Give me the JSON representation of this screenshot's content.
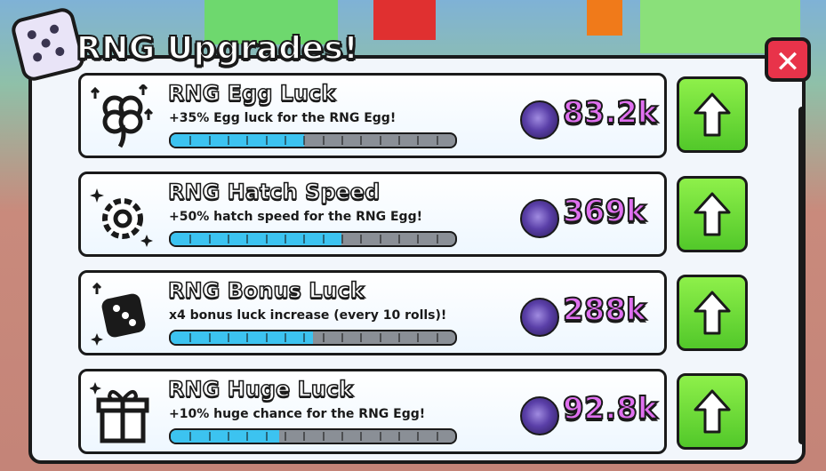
{
  "window": {
    "title": "RNG Upgrades!"
  },
  "close_label": "✕",
  "colors": {
    "accent_price": "#e070f0",
    "progress_fill": "#3cc3f0",
    "upgrade_button": "#6ed83a",
    "close_button": "#e8334a"
  },
  "upgrades": [
    {
      "name": "RNG Egg Luck",
      "description": "+35% Egg luck for the RNG Egg!",
      "price": "83.2k",
      "progress": 0.47,
      "icon": "clover-icon"
    },
    {
      "name": "RNG Hatch Speed",
      "description": "+50% hatch speed for the RNG Egg!",
      "price": "369k",
      "progress": 0.6,
      "icon": "gear-icon"
    },
    {
      "name": "RNG Bonus Luck",
      "description": "x4 bonus luck increase (every 10 rolls)!",
      "price": "288k",
      "progress": 0.5,
      "icon": "dice-icon"
    },
    {
      "name": "RNG Huge Luck",
      "description": "+10% huge chance for the RNG Egg!",
      "price": "92.8k",
      "progress": 0.38,
      "icon": "gift-icon"
    }
  ]
}
